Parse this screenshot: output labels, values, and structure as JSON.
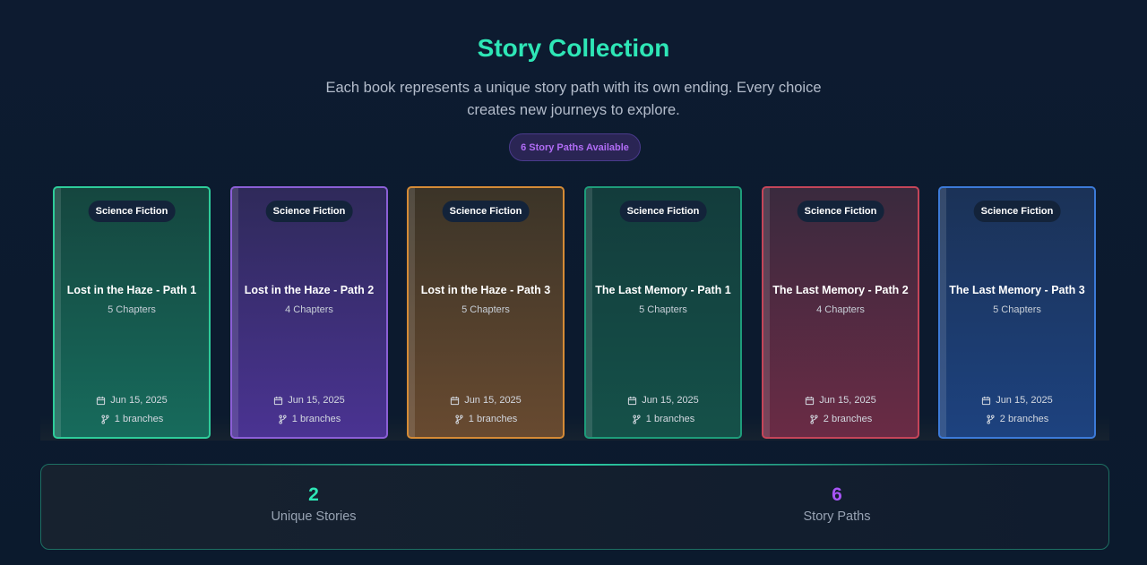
{
  "header": {
    "title": "Story Collection",
    "subtitle": "Each book represents a unique story path with its own ending. Every choice creates new journeys to explore.",
    "badge": "6 Story Paths Available"
  },
  "books": [
    {
      "genre": "Science Fiction",
      "title": "Lost in the Haze - Path 1",
      "chapters": "5 Chapters",
      "date": "Jun 15, 2025",
      "branches": "1 branches"
    },
    {
      "genre": "Science Fiction",
      "title": "Lost in the Haze - Path 2",
      "chapters": "4 Chapters",
      "date": "Jun 15, 2025",
      "branches": "1 branches"
    },
    {
      "genre": "Science Fiction",
      "title": "Lost in the Haze - Path 3",
      "chapters": "5 Chapters",
      "date": "Jun 15, 2025",
      "branches": "1 branches"
    },
    {
      "genre": "Science Fiction",
      "title": "The Last Memory - Path 1",
      "chapters": "5 Chapters",
      "date": "Jun 15, 2025",
      "branches": "1 branches"
    },
    {
      "genre": "Science Fiction",
      "title": "The Last Memory - Path 2",
      "chapters": "4 Chapters",
      "date": "Jun 15, 2025",
      "branches": "2 branches"
    },
    {
      "genre": "Science Fiction",
      "title": "The Last Memory - Path 3",
      "chapters": "5 Chapters",
      "date": "Jun 15, 2025",
      "branches": "2 branches"
    }
  ],
  "stats": {
    "unique_count": "2",
    "unique_label": "Unique Stories",
    "paths_count": "6",
    "paths_label": "Story Paths"
  },
  "icons": {
    "date": "calendar-icon",
    "branches": "git-branch-icon"
  },
  "colors": {
    "accent": "#2ee6b6",
    "secondary": "#a855f7",
    "background": "#0c1a2e"
  }
}
